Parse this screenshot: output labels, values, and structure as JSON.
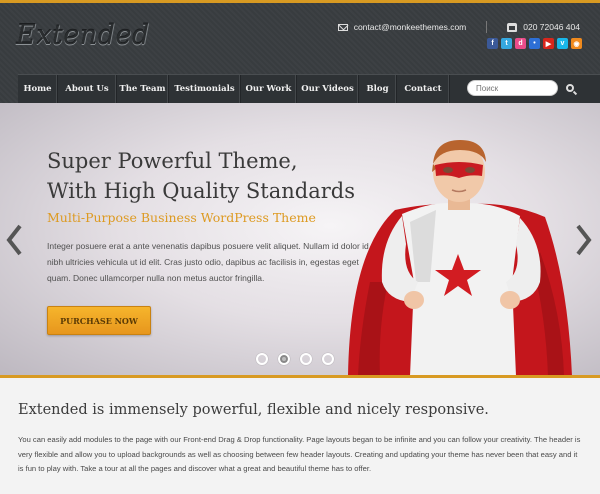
{
  "header": {
    "logo": "Extended",
    "email": "contact@monkeethemes.com",
    "phone": "020 72046 404",
    "social": [
      {
        "name": "facebook",
        "glyph": "f",
        "color": "#3b5998"
      },
      {
        "name": "twitter",
        "glyph": "t",
        "color": "#35a8e0"
      },
      {
        "name": "dribbble",
        "glyph": "d",
        "color": "#ea4c89"
      },
      {
        "name": "flickr",
        "glyph": "•",
        "color": "#2d6fd6"
      },
      {
        "name": "youtube",
        "glyph": "▶",
        "color": "#d8261c"
      },
      {
        "name": "vimeo",
        "glyph": "v",
        "color": "#19b7ea"
      },
      {
        "name": "rss",
        "glyph": "◉",
        "color": "#f08a1d"
      }
    ]
  },
  "nav": {
    "items": [
      "Home",
      "About Us",
      "The Team",
      "Testimonials",
      "Our Work",
      "Our Videos",
      "Blog",
      "Contact"
    ],
    "search_placeholder": "Поиск"
  },
  "hero": {
    "title_line1": "Super Powerful Theme,",
    "title_line2": "With High Quality Standards",
    "subtitle": "Multi-Purpose Business WordPress Theme",
    "text": "Integer posuere erat a ante venenatis dapibus posuere velit aliquet. Nullam id dolor id nibh ultricies vehicula ut id elit. Cras justo odio, dapibus ac facilisis in, egestas eget quam. Donec ullamcorper nulla non metus auctor fringilla.",
    "button": "PURCHASE NOW",
    "slide_count": 4,
    "active_slide": 2
  },
  "content": {
    "title": "Extended is immensely powerful, flexible and nicely responsive.",
    "text": "You can easily add modules to the page with our Front-end Drag & Drop functionality. Page layouts began to be infinite and you can follow your creativity. The header is very flexible and allow you to upload backgrounds as well as choosing between few header layouts. Creating and updating your theme has never been that easy and it is fun to play with. Take a tour at all the pages and discover what a great and beautiful theme has to offer."
  },
  "colors": {
    "accent": "#d89a22",
    "header_bg": "#383c3f",
    "subtitle": "#dd9a21"
  }
}
